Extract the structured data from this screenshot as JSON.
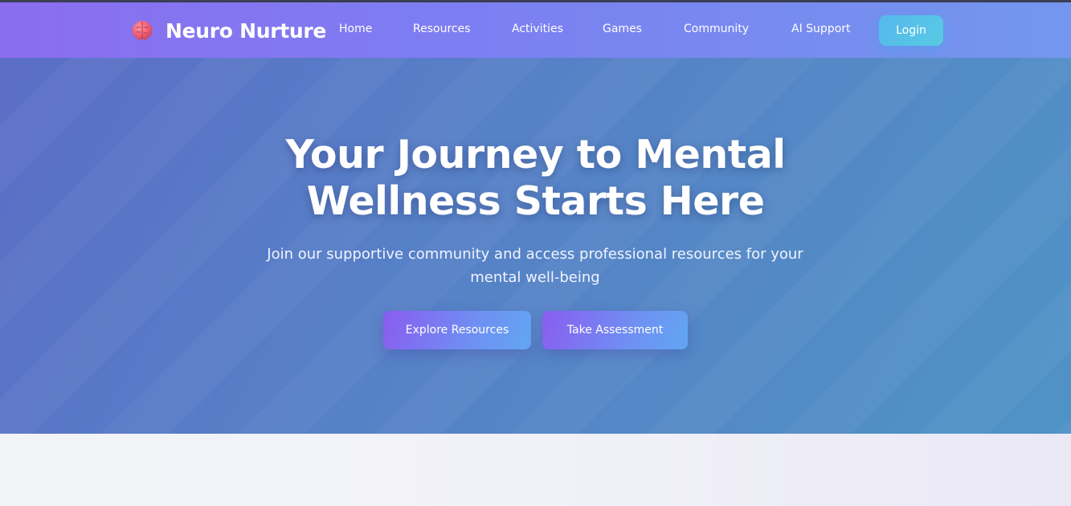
{
  "nav": {
    "brand": "Neuro Nurture",
    "brand_icon": "brain-icon",
    "links": [
      "Home",
      "Resources",
      "Activities",
      "Games",
      "Community",
      "AI Support"
    ],
    "login": "Login"
  },
  "hero": {
    "title_line1": "Your Journey to Mental",
    "title_line2": "Wellness Starts Here",
    "subtitle": "Join our supportive community and access professional resources for your mental well-being",
    "buttons": {
      "explore": "Explore Resources",
      "assessment": "Take Assessment"
    }
  },
  "colors": {
    "nav_gradient_start": "#8b6df0",
    "nav_gradient_end": "#7397ee",
    "hero_gradient_start": "#5b6dc6",
    "hero_gradient_end": "#4f93c6",
    "login_accent": "#56b7ee",
    "cta_gradient_start": "#8a5cf0",
    "cta_gradient_end": "#62a6f2"
  }
}
